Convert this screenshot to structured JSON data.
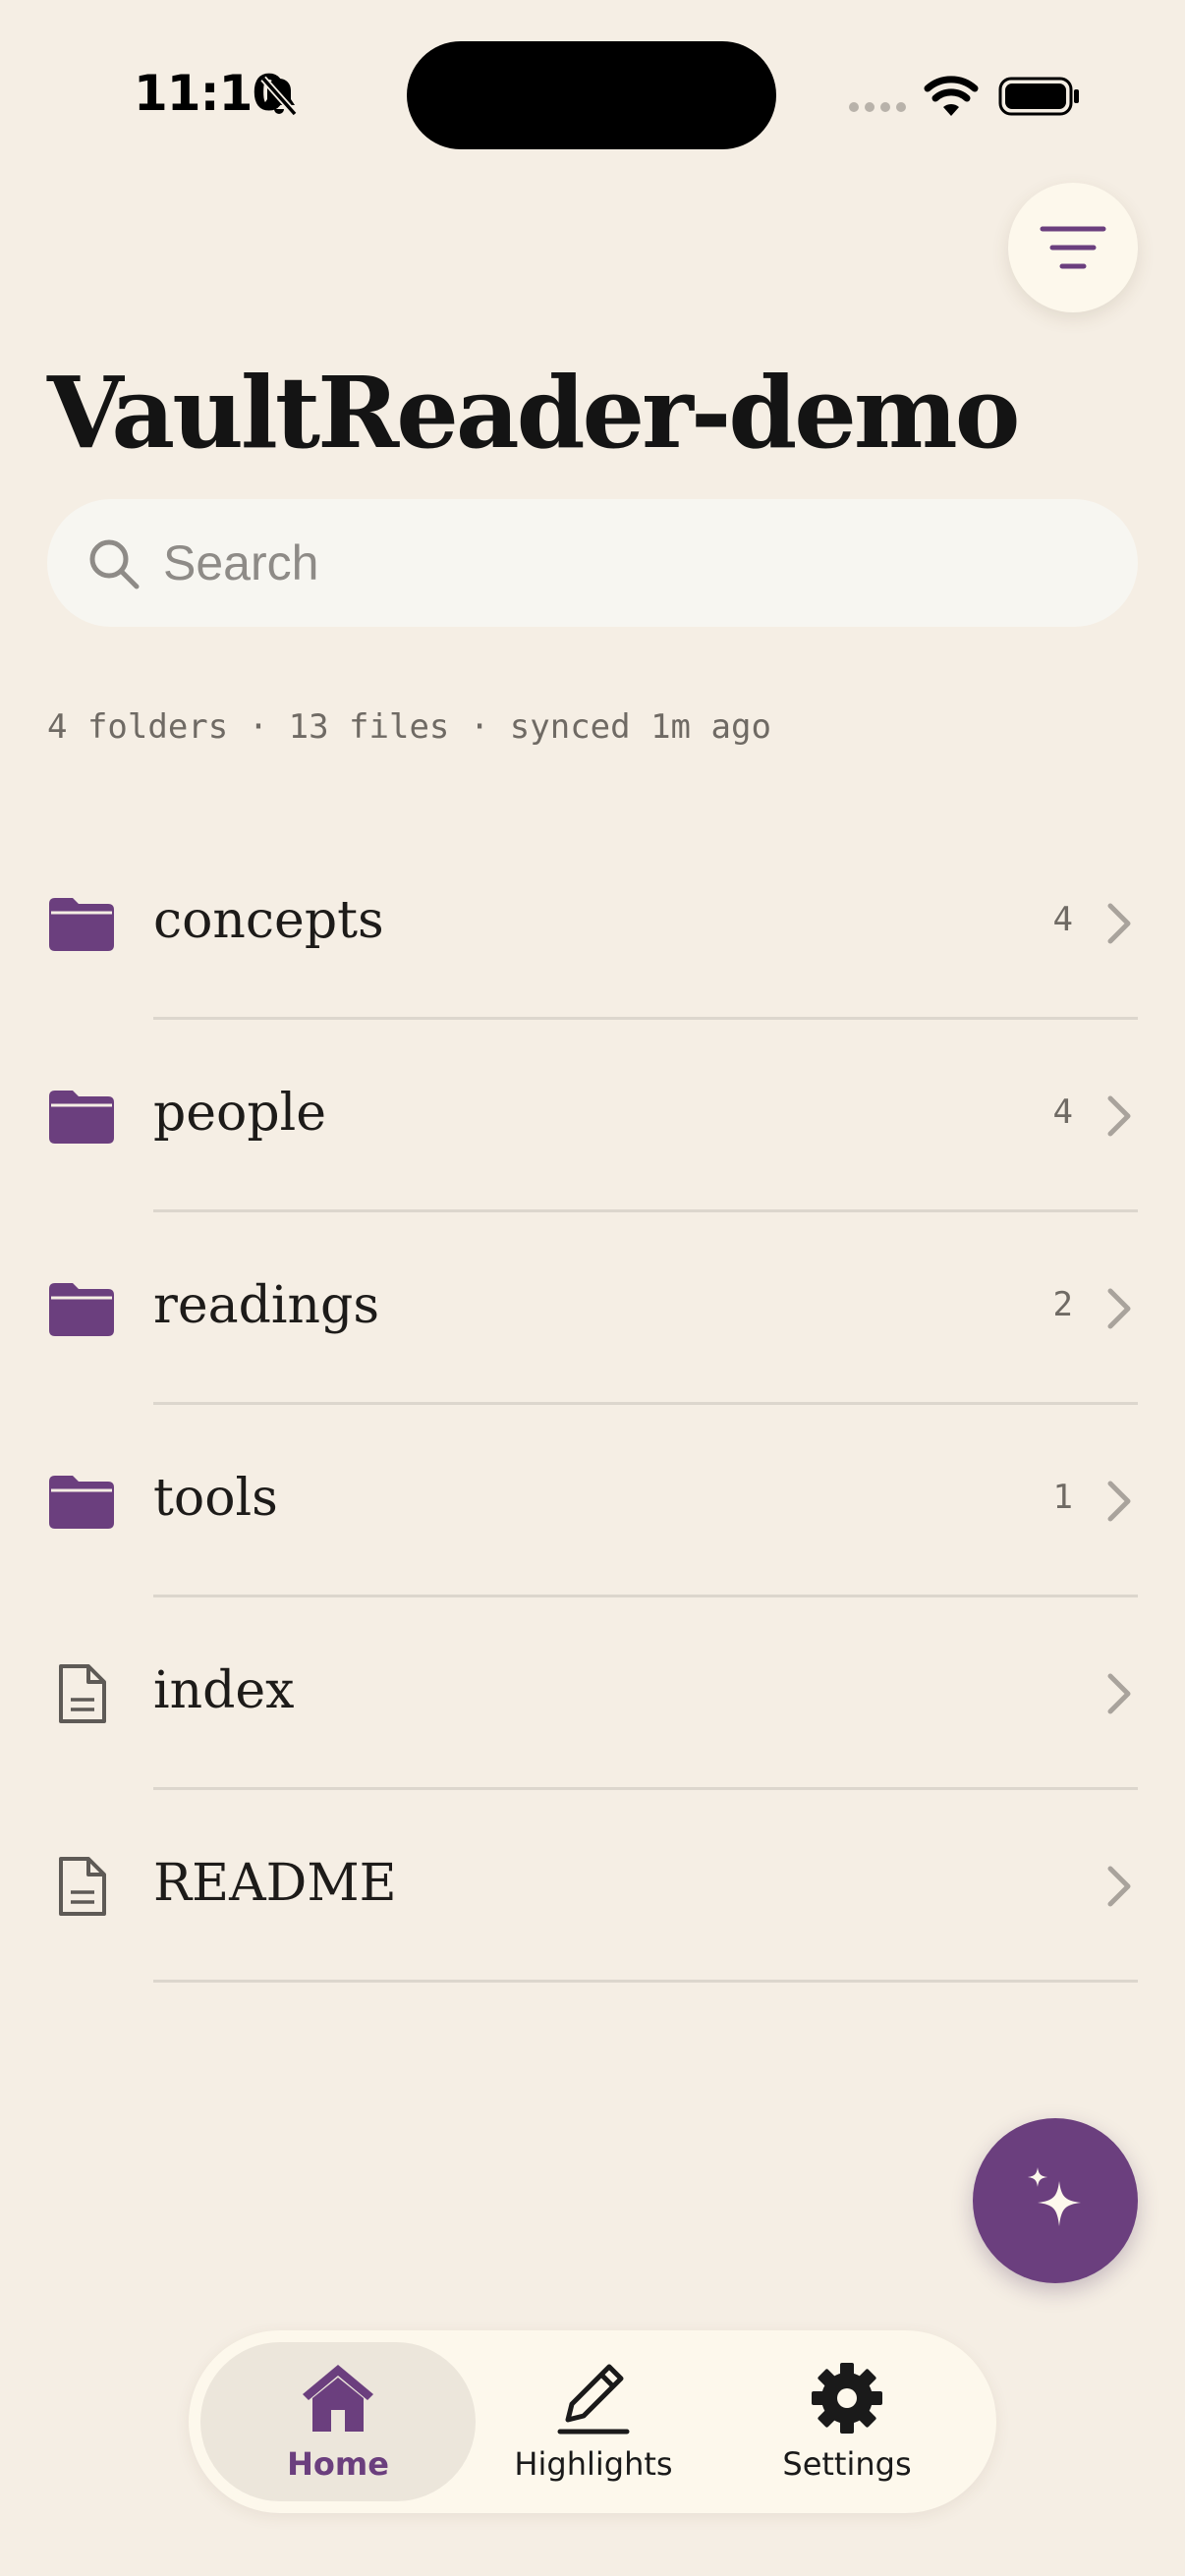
{
  "status_bar": {
    "time": "11:10"
  },
  "header": {
    "title": "VaultReader-demo"
  },
  "search": {
    "placeholder": "Search",
    "value": ""
  },
  "summary": "4 folders · 13 files · synced 1m ago",
  "items": [
    {
      "type": "folder",
      "label": "concepts",
      "count": "4"
    },
    {
      "type": "folder",
      "label": "people",
      "count": "4"
    },
    {
      "type": "folder",
      "label": "readings",
      "count": "2"
    },
    {
      "type": "folder",
      "label": "tools",
      "count": "1"
    },
    {
      "type": "file",
      "label": "index",
      "count": ""
    },
    {
      "type": "file",
      "label": "README",
      "count": ""
    }
  ],
  "tabs": [
    {
      "label": "Home",
      "icon": "home-icon",
      "active": true
    },
    {
      "label": "Highlights",
      "icon": "pencil-icon",
      "active": false
    },
    {
      "label": "Settings",
      "icon": "gear-icon",
      "active": false
    }
  ],
  "colors": {
    "background": "#f5eee4",
    "accent": "#6b3f7e",
    "surface": "#fdf8ec"
  }
}
